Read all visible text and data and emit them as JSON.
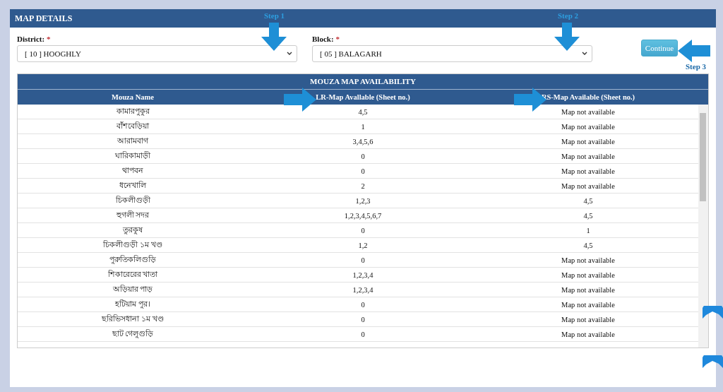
{
  "panel": {
    "title": "MAP DETAILS"
  },
  "form": {
    "fields": [
      {
        "label": "District:",
        "required": "*",
        "value": "[ 10 ] HOOGHLY"
      },
      {
        "label": "Block:",
        "required": "*",
        "value": "[ 05 ] BALAGARH"
      }
    ],
    "button": "Continue"
  },
  "table": {
    "title": "MOUZA MAP AVAILABILITY",
    "columns": [
      "Mouza Name",
      "LR-Map Avallable (Sheet no.)",
      "RS-Map Available (Sheet no.)"
    ],
    "rows": [
      [
        "কামারপুকুর",
        "4,5",
        "Map not available"
      ],
      [
        "বাঁশবেড়িয়া",
        "1",
        "Map not available"
      ],
      [
        "আরামবাগ",
        "3,4,5,6",
        "Map not available"
      ],
      [
        "ঘারিকামাড়ী",
        "0",
        "Map not available"
      ],
      [
        "থাপবন",
        "0",
        "Map not available"
      ],
      [
        "ধনেখালি",
        "2",
        "Map not available"
      ],
      [
        "চিকলীগুড়ী",
        "1,2,3",
        "4,5"
      ],
      [
        "হুগলী সদর",
        "1,2,3,4,5,6,7",
        "4,5"
      ],
      [
        "তুরকুষ",
        "0",
        "1"
      ],
      [
        "চিকলীগুড়ী ১ম খণ্ড",
        "1,2",
        "4,5"
      ],
      [
        "পুরুতিকলিগুড়ি",
        "0",
        "Map not available"
      ],
      [
        "শিকারেরের খাতা",
        "1,2,3,4",
        "Map not available"
      ],
      [
        "অড়িয়ার পাড়",
        "1,2,3,4",
        "Map not available"
      ],
      [
        "হটিয়াম পুর।",
        "0",
        "Map not available"
      ],
      [
        "ছরিভিসধানা ১ম খণ্ড",
        "0",
        "Map not available"
      ],
      [
        "ছাট গেলুগুড়ি",
        "0",
        "Map not available"
      ]
    ]
  },
  "steps": [
    {
      "label": "Step 1"
    },
    {
      "label": "Step 2"
    },
    {
      "label": "Step 3"
    }
  ]
}
